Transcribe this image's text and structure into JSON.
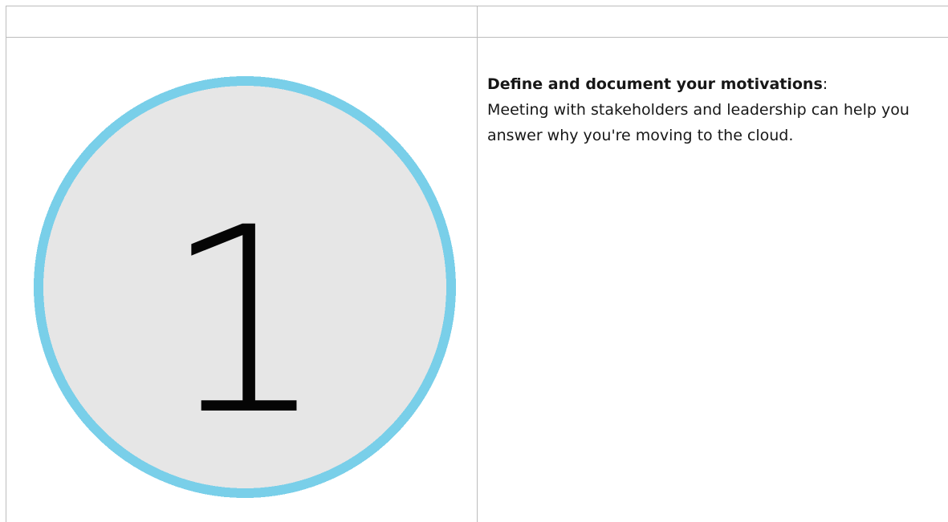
{
  "step": {
    "number": "1",
    "circle_fill": "#e6e6e6",
    "circle_border": "#79cfe9",
    "number_color": "#050505"
  },
  "content": {
    "title": "Define and document your motivations",
    "title_suffix": ":",
    "description": "Meeting with stakeholders and leadership can help you answer why you're moving to the cloud."
  }
}
